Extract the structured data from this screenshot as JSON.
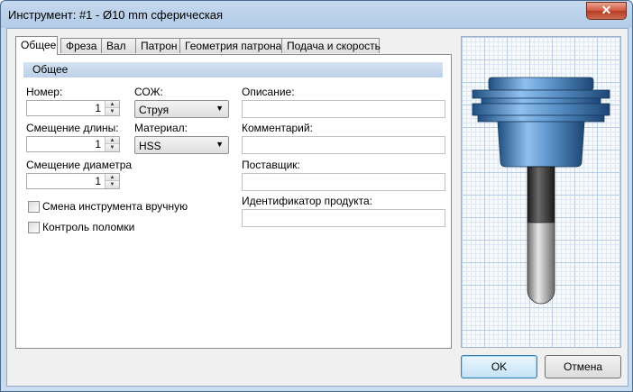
{
  "window": {
    "title": "Инструмент: #1 - Ø10 mm сферическая"
  },
  "tabs": [
    {
      "label": "Общее",
      "active": true
    },
    {
      "label": "Фреза",
      "active": false
    },
    {
      "label": "Вал",
      "active": false
    },
    {
      "label": "Патрон",
      "active": false
    },
    {
      "label": "Геометрия патрона",
      "active": false
    },
    {
      "label": "Подача и скорость",
      "active": false
    }
  ],
  "general": {
    "section_title": "Общее",
    "number": {
      "label": "Номер:",
      "value": "1"
    },
    "length_offset": {
      "label": "Смещение длины:",
      "value": "1"
    },
    "diameter_offset": {
      "label": "Смещение диаметра",
      "value": "1"
    },
    "coolant": {
      "label": "СОЖ:",
      "value": "Струя"
    },
    "material": {
      "label": "Материал:",
      "value": "HSS"
    },
    "description": {
      "label": "Описание:",
      "value": ""
    },
    "comment": {
      "label": "Комментарий:",
      "value": ""
    },
    "supplier": {
      "label": "Поставщик:",
      "value": ""
    },
    "product_id": {
      "label": "Идентификатор продукта:",
      "value": ""
    },
    "manual_change": {
      "label": "Смена инструмента вручную",
      "checked": false
    },
    "break_control": {
      "label": "Контроль поломки",
      "checked": false
    }
  },
  "buttons": {
    "ok": "OK",
    "cancel": "Отмена"
  },
  "icons": {
    "close": "close-icon",
    "spin_up": "spin-up-icon",
    "spin_down": "spin-down-icon",
    "dropdown": "chevron-down-icon"
  },
  "colors": {
    "title_bar": "#b3cbe6",
    "close_button": "#c7472d",
    "section_header": "#c6d8ec",
    "tool_holder": "#5b93c9",
    "tool_shank": "#555555"
  }
}
